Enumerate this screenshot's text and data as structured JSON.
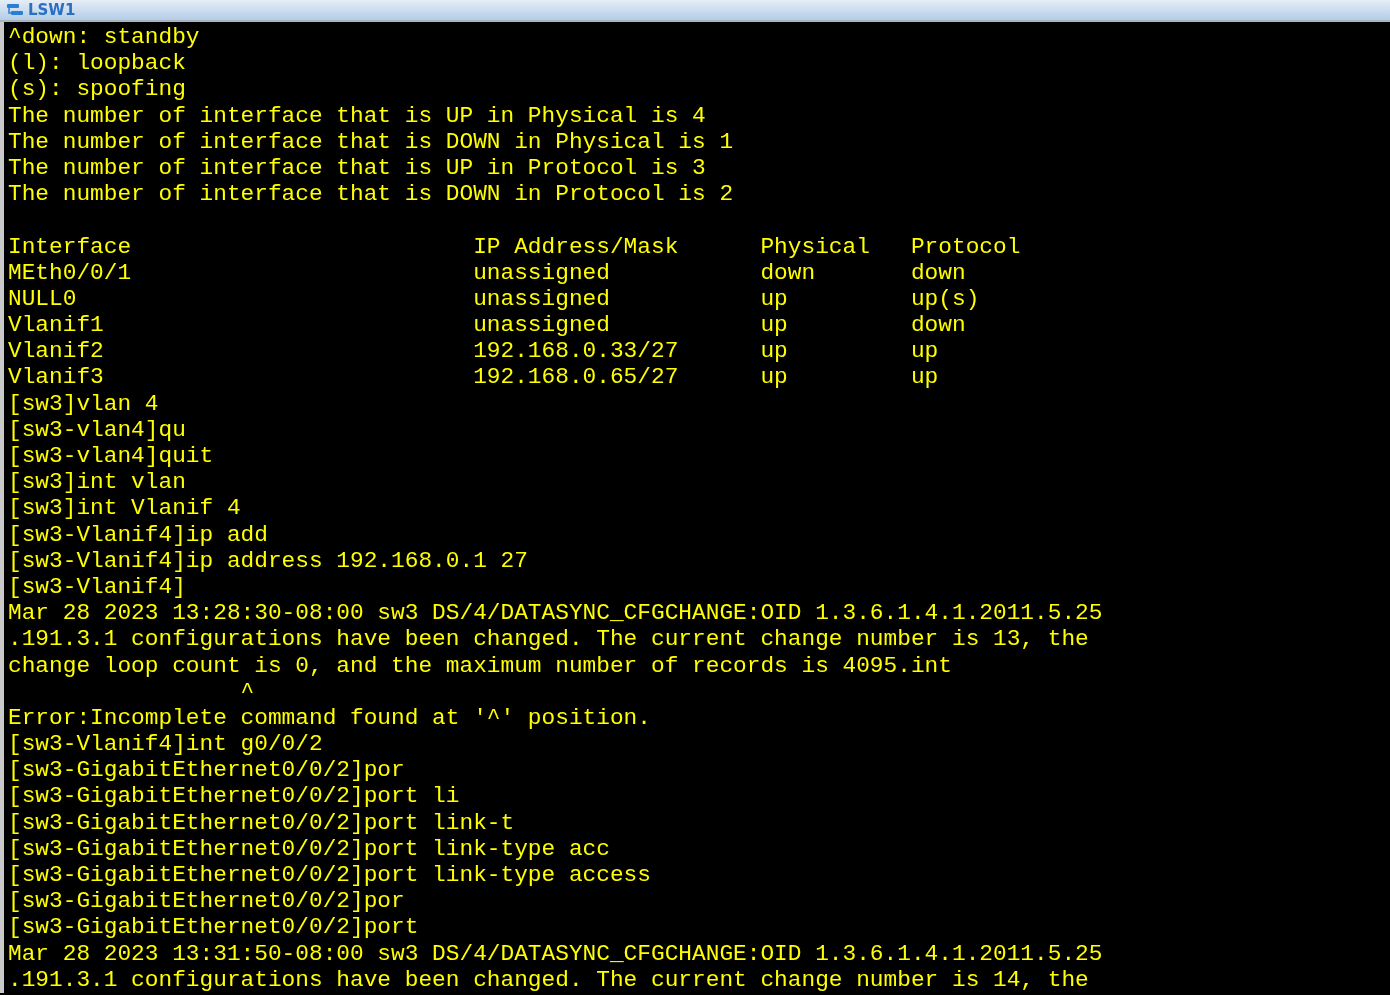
{
  "window": {
    "title": "LSW1"
  },
  "terminal": {
    "lines": [
      {
        "kind": "text",
        "text": "^down: standby"
      },
      {
        "kind": "text",
        "text": "(l): loopback"
      },
      {
        "kind": "text",
        "text": "(s): spoofing"
      },
      {
        "kind": "text",
        "text": "The number of interface that is UP in Physical is 4"
      },
      {
        "kind": "text",
        "text": "The number of interface that is DOWN in Physical is 1"
      },
      {
        "kind": "text",
        "text": "The number of interface that is UP in Protocol is 3"
      },
      {
        "kind": "text",
        "text": "The number of interface that is DOWN in Protocol is 2"
      },
      {
        "kind": "blank"
      },
      {
        "kind": "text",
        "text": "Interface                         IP Address/Mask      Physical   Protocol"
      },
      {
        "kind": "text",
        "text": "MEth0/0/1                         unassigned           down       down"
      },
      {
        "kind": "text",
        "text": "NULL0                             unassigned           up         up(s)"
      },
      {
        "kind": "text",
        "text": "Vlanif1                           unassigned           up         down"
      },
      {
        "kind": "text",
        "text": "Vlanif2                           192.168.0.33/27      up         up"
      },
      {
        "kind": "text",
        "text": "Vlanif3                           192.168.0.65/27      up         up"
      },
      {
        "kind": "text",
        "text": "[sw3]vlan 4"
      },
      {
        "kind": "text",
        "text": "[sw3-vlan4]qu"
      },
      {
        "kind": "text",
        "text": "[sw3-vlan4]quit"
      },
      {
        "kind": "text",
        "text": "[sw3]int vlan"
      },
      {
        "kind": "text",
        "text": "[sw3]int Vlanif 4"
      },
      {
        "kind": "text",
        "text": "[sw3-Vlanif4]ip add"
      },
      {
        "kind": "text",
        "text": "[sw3-Vlanif4]ip address 192.168.0.1 27"
      },
      {
        "kind": "text",
        "text": "[sw3-Vlanif4]"
      },
      {
        "kind": "text",
        "text": "Mar 28 2023 13:28:30-08:00 sw3 DS/4/DATASYNC_CFGCHANGE:OID 1.3.6.1.4.1.2011.5.25"
      },
      {
        "kind": "text",
        "text": ".191.3.1 configurations have been changed. The current change number is 13, the"
      },
      {
        "kind": "text",
        "text": "change loop count is 0, and the maximum number of records is 4095.int"
      },
      {
        "kind": "text",
        "text": "                 ^"
      },
      {
        "kind": "text",
        "text": "Error:Incomplete command found at '^' position."
      },
      {
        "kind": "text",
        "text": "[sw3-Vlanif4]int g0/0/2"
      },
      {
        "kind": "text",
        "text": "[sw3-GigabitEthernet0/0/2]por"
      },
      {
        "kind": "text",
        "text": "[sw3-GigabitEthernet0/0/2]port li"
      },
      {
        "kind": "text",
        "text": "[sw3-GigabitEthernet0/0/2]port link-t"
      },
      {
        "kind": "text",
        "text": "[sw3-GigabitEthernet0/0/2]port link-type acc"
      },
      {
        "kind": "text",
        "text": "[sw3-GigabitEthernet0/0/2]port link-type access"
      },
      {
        "kind": "text",
        "text": "[sw3-GigabitEthernet0/0/2]por"
      },
      {
        "kind": "text",
        "text": "[sw3-GigabitEthernet0/0/2]port"
      },
      {
        "kind": "text",
        "text": "Mar 28 2023 13:31:50-08:00 sw3 DS/4/DATASYNC_CFGCHANGE:OID 1.3.6.1.4.1.2011.5.25"
      },
      {
        "kind": "text",
        "text": ".191.3.1 configurations have been changed. The current change number is 14, the"
      }
    ]
  }
}
